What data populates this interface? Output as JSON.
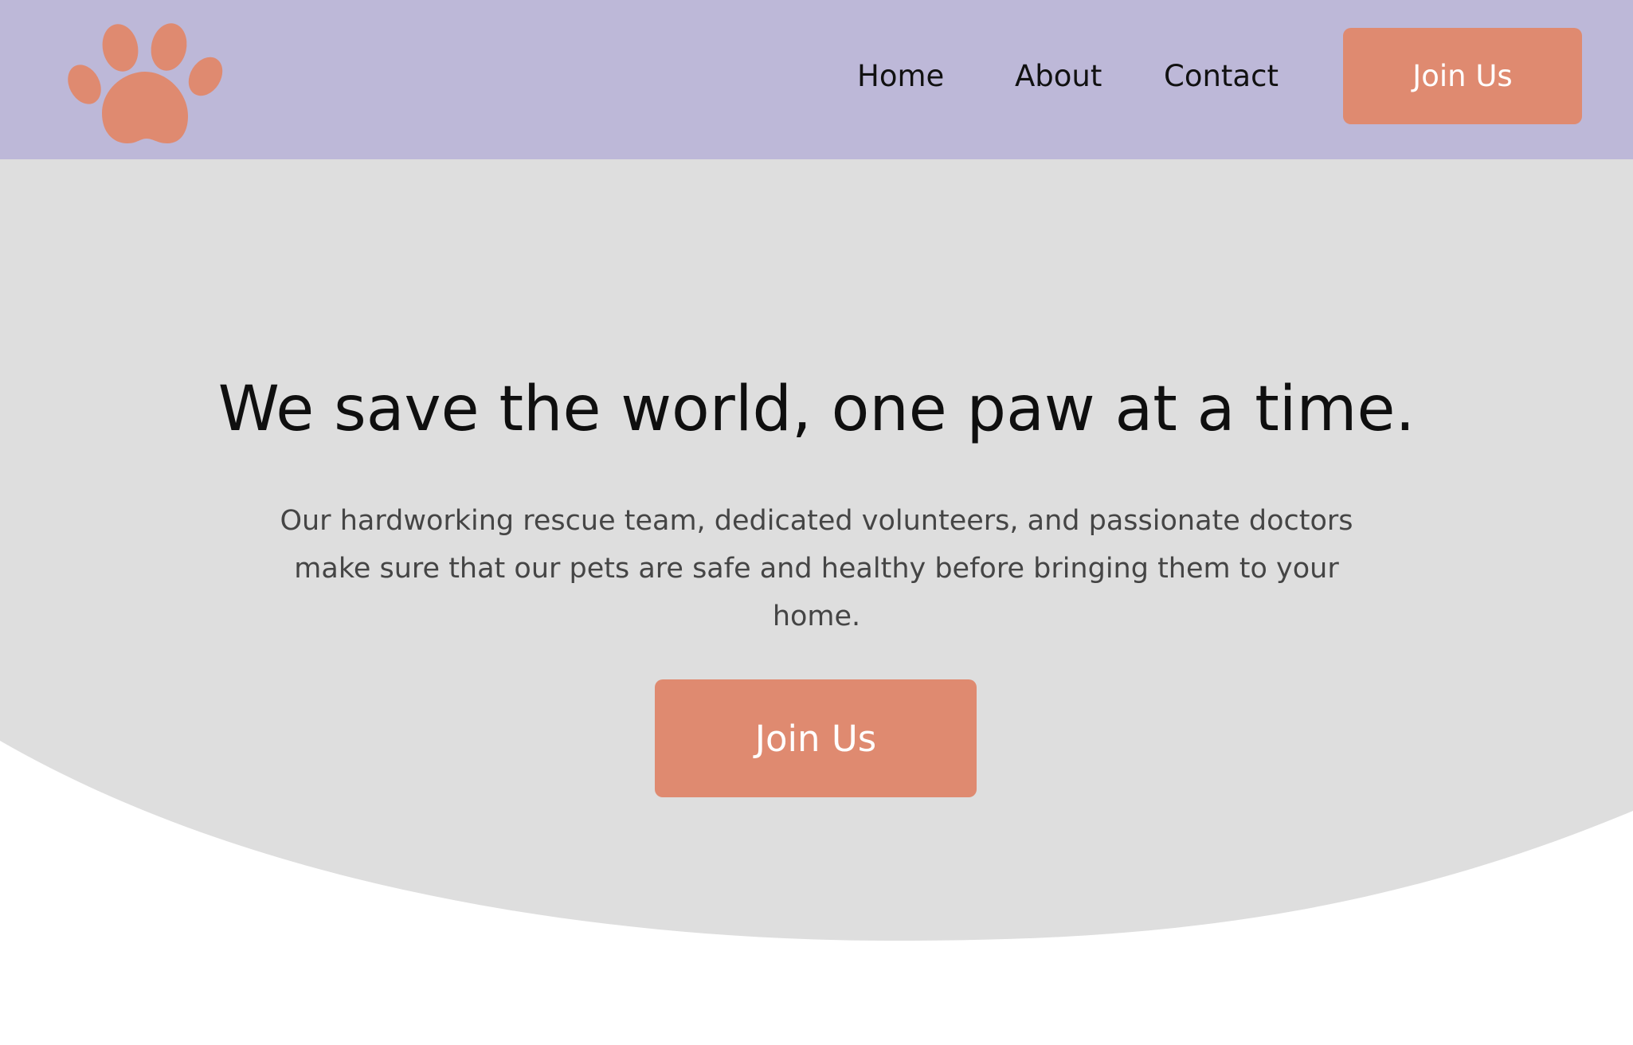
{
  "colors": {
    "header_bg": "#bdb8d8",
    "hero_bg": "#dedede",
    "accent": "#df8a70",
    "page_bg": "#ffffff",
    "heading_text": "#0f0f0f",
    "body_text": "#454545"
  },
  "header": {
    "logo_icon": "paw-print-icon",
    "nav": {
      "home": "Home",
      "about": "About",
      "contact": "Contact"
    },
    "cta_label": "Join Us"
  },
  "hero": {
    "title": "We save the world, one paw at a time.",
    "description": "Our hardworking rescue team, dedicated volunteers, and passionate doctors make sure that our pets are safe and healthy before bringing them to your home.",
    "cta_label": "Join Us"
  }
}
